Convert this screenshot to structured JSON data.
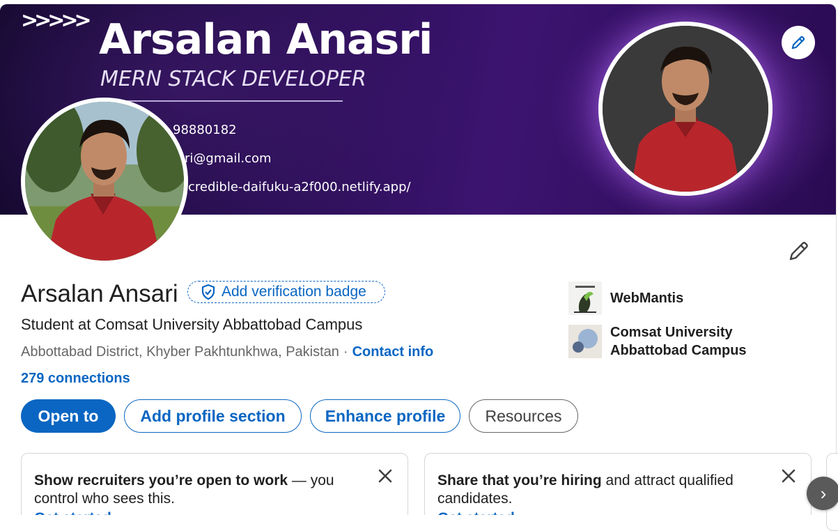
{
  "banner": {
    "chevrons": ">>>>>",
    "name": "Arsalan Anasri",
    "role": "MERN STACK DEVELOPER",
    "phone_fragment": "98880182",
    "email_fragment": "ri@gmail.com",
    "site_fragment": "credible-daifuku-a2f000.netlify.app/"
  },
  "profile": {
    "name": "Arsalan Ansari",
    "verification_badge_label": "Add verification badge",
    "headline": "Student at Comsat University Abbattobad Campus",
    "location": "Abbottabad District, Khyber Pakhtunkhwa, Pakistan",
    "separator": "·",
    "contact_info_label": "Contact info",
    "connections": "279 connections"
  },
  "organizations": [
    {
      "name": "WebMantis",
      "icon": "webmantis-logo"
    },
    {
      "name_line1": "Comsat University",
      "name_line2": "Abbattobad Campus",
      "icon": "university-logo"
    }
  ],
  "actions": {
    "open_to": "Open to",
    "add_section": "Add profile section",
    "enhance": "Enhance profile",
    "resources": "Resources"
  },
  "suggestions": [
    {
      "bold": "Show recruiters you’re open to work",
      "rest": " — you control who sees this.",
      "cta": "Get started"
    },
    {
      "bold": "Share that you’re hiring",
      "rest": " and attract qualified candidates.",
      "cta": "Get started"
    }
  ],
  "icons": {
    "edit_banner": "pencil-icon",
    "edit_intro": "pencil-icon",
    "verify": "shield-check-icon",
    "close": "close-icon",
    "next": "chevron-right-icon"
  },
  "colors": {
    "accent": "#0a66c2",
    "banner_dark": "#12082a",
    "banner_purple": "#3c1470"
  },
  "next_label": "›"
}
